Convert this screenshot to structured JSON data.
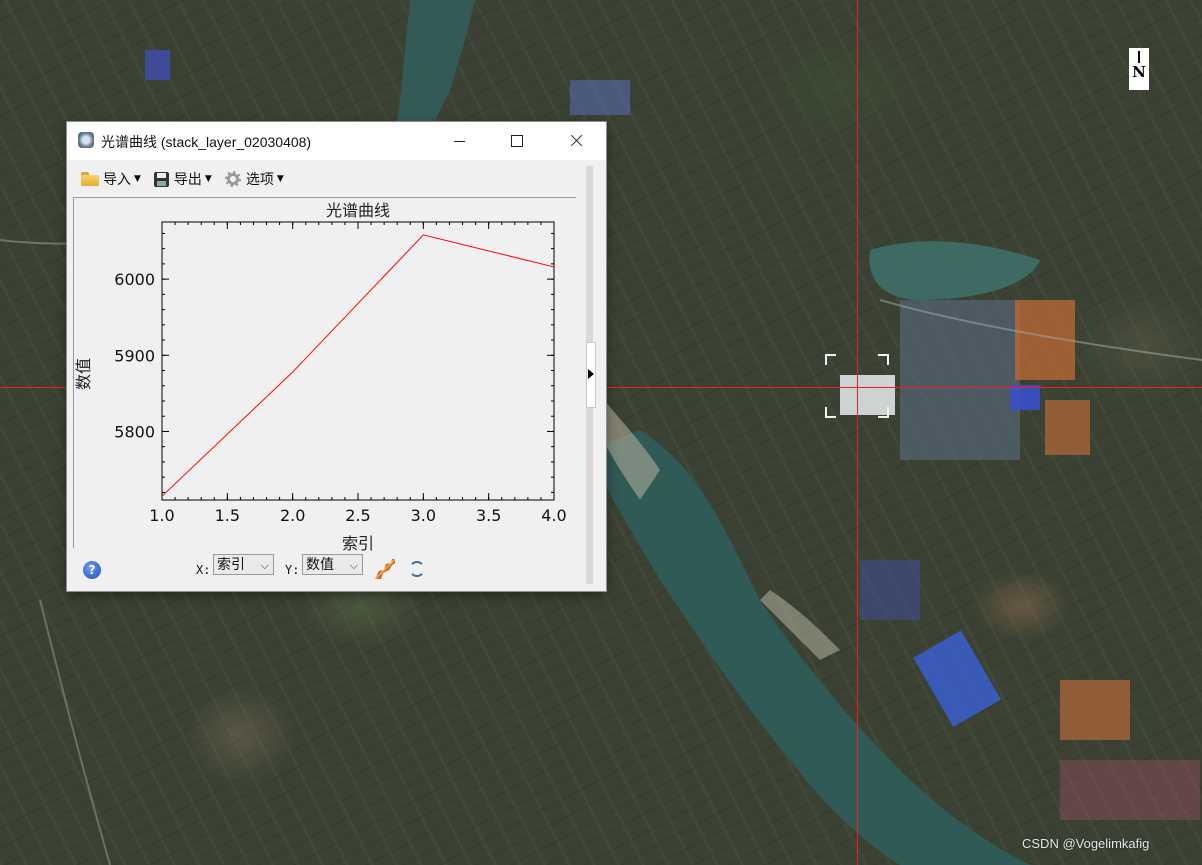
{
  "window": {
    "title": "光谱曲线 (stack_layer_02030408)"
  },
  "toolbar": {
    "import_label": "导入",
    "export_label": "导出",
    "options_label": "选项"
  },
  "chart_data": {
    "type": "line",
    "title": "光谱曲线",
    "xlabel": "索引",
    "ylabel": "数值",
    "x": [
      1.0,
      2.0,
      3.0,
      4.0
    ],
    "series": [
      {
        "values": [
          5715,
          5878,
          6058,
          6016
        ],
        "color": "#ff0000"
      }
    ],
    "xlim": [
      1.0,
      4.0
    ],
    "ylim": [
      5710,
      6075
    ],
    "x_ticks": [
      "1.0",
      "1.5",
      "2.0",
      "2.5",
      "3.0",
      "3.5",
      "4.0"
    ],
    "y_ticks": [
      "5800",
      "5900",
      "6000"
    ],
    "grid": false
  },
  "bottombar": {
    "x_axis_label": "X:",
    "x_select_value": "索引",
    "y_axis_label": "Y:",
    "y_select_value": "数值",
    "help_symbol": "?"
  },
  "map": {
    "north_label": "N",
    "crosshair_color": "#ff1a1a"
  },
  "watermark": "CSDN @Vogelimkafig"
}
